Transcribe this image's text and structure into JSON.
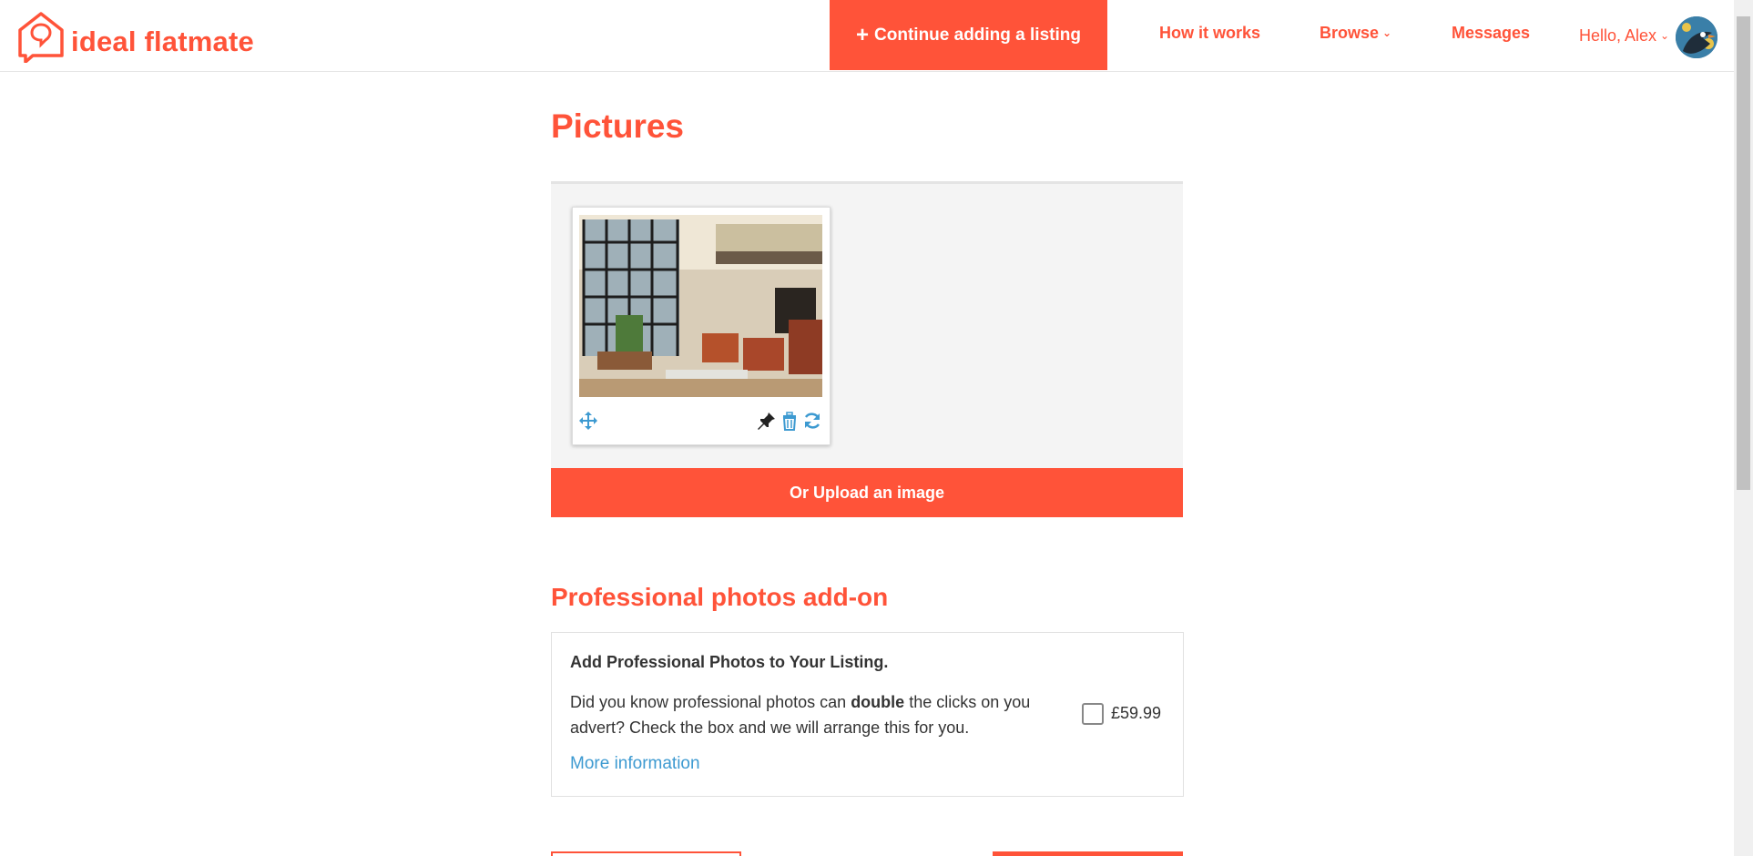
{
  "nav": {
    "brand": "ideal flatmate",
    "cta_label": "Continue adding a listing",
    "cta_icon": "plus-icon",
    "links": [
      "How it works",
      "Browse",
      "Messages"
    ],
    "greeting": "Hello, Alex",
    "accent_color": "#ff5339"
  },
  "main": {
    "title": "Pictures",
    "photo_tools": [
      "move-icon",
      "pin-icon",
      "trash-icon",
      "rotate-icon"
    ],
    "upload_label": "Or Upload an image"
  },
  "addon": {
    "heading": "Professional photos add-on",
    "title": "Add Professional Photos to Your Listing.",
    "desc_before": "Did you know professional photos can ",
    "desc_bold": "double",
    "desc_after": " the clicks on you advert? Check the box and we will arrange this for you.",
    "more_info": "More information",
    "price": "£59.99",
    "checked": false
  }
}
